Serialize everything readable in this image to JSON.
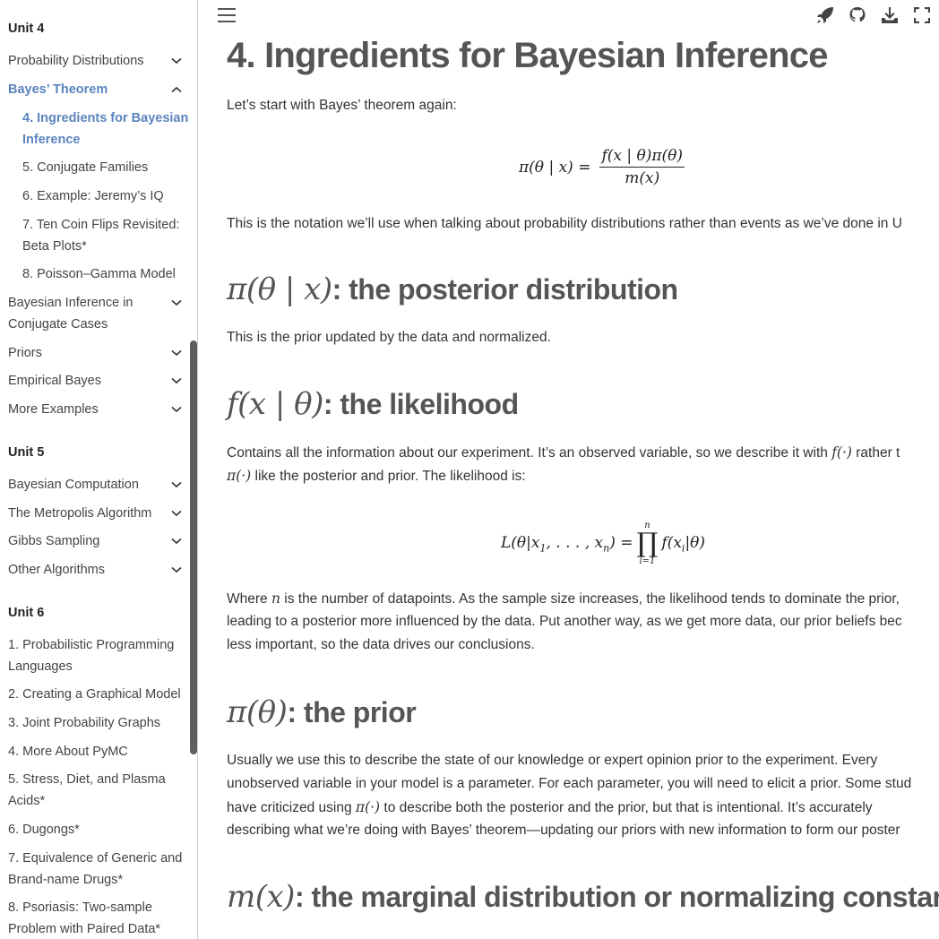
{
  "sidebar": {
    "unit4": {
      "title": "Unit 4",
      "items": [
        {
          "label": "Probability Distributions",
          "expanded": false
        },
        {
          "label": "Bayes’ Theorem",
          "expanded": true,
          "active": true
        },
        {
          "label": "Bayesian Inference in Conjugate Cases",
          "expanded": false
        },
        {
          "label": "Priors",
          "expanded": false
        },
        {
          "label": "Empirical Bayes",
          "expanded": false
        },
        {
          "label": "More Examples",
          "expanded": false
        }
      ],
      "bayes_children": [
        {
          "label": "4. Ingredients for Bayesian Inference",
          "active": true
        },
        {
          "label": "5. Conjugate Families"
        },
        {
          "label": "6. Example: Jeremy’s IQ"
        },
        {
          "label": "7. Ten Coin Flips Revisited: Beta Plots*"
        },
        {
          "label": "8. Poisson–Gamma Model"
        }
      ]
    },
    "unit5": {
      "title": "Unit 5",
      "items": [
        {
          "label": "Bayesian Computation"
        },
        {
          "label": "The Metropolis Algorithm"
        },
        {
          "label": "Gibbs Sampling"
        },
        {
          "label": "Other Algorithms"
        }
      ]
    },
    "unit6": {
      "title": "Unit 6",
      "items": [
        {
          "label": "1. Probabilistic Programming Languages"
        },
        {
          "label": "2. Creating a Graphical Model"
        },
        {
          "label": "3. Joint Probability Graphs"
        },
        {
          "label": "4. More About PyMC"
        },
        {
          "label": "5. Stress, Diet, and Plasma Acids*"
        },
        {
          "label": "6. Dugongs*"
        },
        {
          "label": "7. Equivalence of Generic and Brand-name Drugs*"
        },
        {
          "label": "8. Psoriasis: Two-sample Problem with Paired Data*"
        }
      ]
    }
  },
  "topbar": {
    "icons": [
      "menu-icon",
      "rocket-icon",
      "github-icon",
      "download-icon",
      "fullscreen-icon"
    ]
  },
  "colors": {
    "accent": "#5a84bd",
    "heading": "#555555",
    "text": "#333333",
    "scrollbar": "#5f5f5f"
  },
  "page": {
    "title": "4. Ingredients for Bayesian Inference",
    "intro": "Let’s start with Bayes’ theorem again:",
    "bayes_eq": {
      "lhs": "π(θ | x) =",
      "num": "f(x | θ)π(θ)",
      "den": "m(x)"
    },
    "notation_text": "This is the notation we’ll use when talking about probability distributions rather than events as we’ve done in U",
    "sections": [
      {
        "math": "π(θ | x)",
        "title": ": the posterior distribution",
        "text": "This is the prior updated by the data and normalized."
      },
      {
        "math": "f(x | θ)",
        "title": ": the likelihood",
        "text_line1_a": "Contains all the information about our experiment. It’s an observed variable, so we describe it with ",
        "text_line1_math": "f(·)",
        "text_line1_b": " rather t",
        "text_line2_math": "π(·)",
        "text_line2_b": " like the posterior and prior. The likelihood is:",
        "eq_lhs": "L(θ|x",
        "eq_lhs_sub1": "1",
        "eq_lhs_mid": ", . . . , x",
        "eq_lhs_subn": "n",
        "eq_lhs_end": ") =",
        "prod_top": "n",
        "prod_bottom": "i=1",
        "eq_rhs": "f(x",
        "eq_rhs_sub": "i",
        "eq_rhs_end": "|θ)",
        "after_a": "Where ",
        "after_math": "n",
        "after_b": " is the number of datapoints. As the sample size increases, the likelihood tends to dominate the prior,",
        "after_line2": "leading to a posterior more influenced by the data. Put another way, as we get more data, our prior beliefs bec",
        "after_line3": "less important, so the data drives our conclusions."
      },
      {
        "math": "π(θ)",
        "title": ": the prior",
        "line1": "Usually we use this to describe the state of our knowledge or expert opinion prior to the experiment. Every",
        "line2": "unobserved variable in your model is a parameter. For each parameter, you will need to elicit a prior. Some stud",
        "line3_a": "have criticized using ",
        "line3_math": "π(·)",
        "line3_b": " to describe both the posterior and the prior, but that is intentional. It’s accurately",
        "line4": "describing what we’re doing with Bayes’ theorem—updating our priors with new information to form our poster"
      },
      {
        "math": "m(x)",
        "title": ": the marginal distribution or normalizing constant"
      }
    ]
  }
}
